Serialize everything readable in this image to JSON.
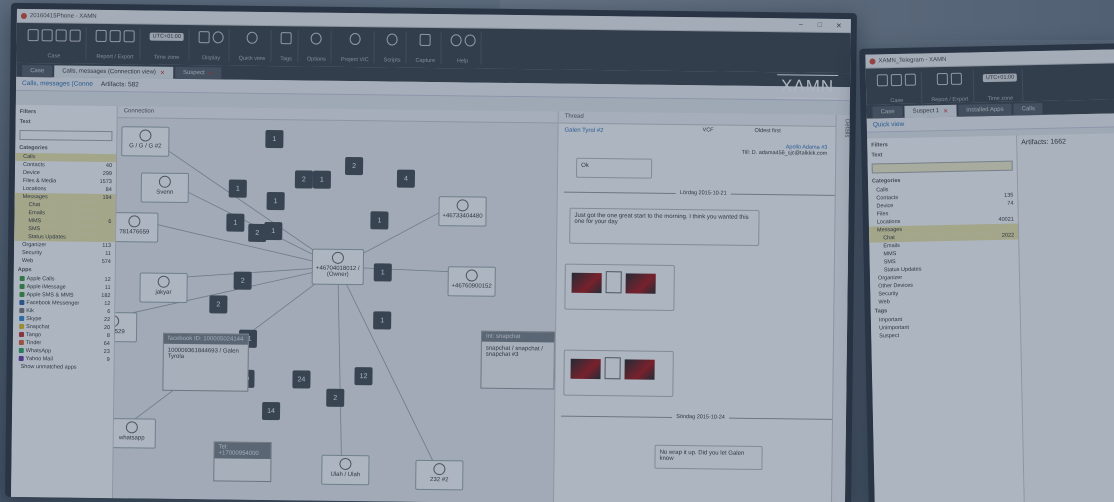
{
  "app": {
    "title_main": "20160415Phone - XAMN",
    "title_second": "XAMN_Telegram - XAMN",
    "brand": "XAMN"
  },
  "ribbon": {
    "groups": [
      {
        "label": "Case"
      },
      {
        "label": "Report / Export"
      },
      {
        "label": "Time zone",
        "value": "UTC+01:00"
      },
      {
        "label": "Display"
      },
      {
        "label": "Quick view"
      },
      {
        "label": "Tags"
      },
      {
        "label": "Options"
      },
      {
        "label": "Project VIC"
      },
      {
        "label": "Scripts"
      },
      {
        "label": "Capture"
      },
      {
        "label": "Help"
      }
    ]
  },
  "tabs": [
    {
      "label": "Case",
      "active": false
    },
    {
      "label": "Calls, messages (Connection view)",
      "active": true
    },
    {
      "label": "Suspect",
      "active": false
    }
  ],
  "toolbar": {
    "filter_link": "Calls, messages (Conne",
    "artifacts": "Artifacts: 582",
    "view_label": "Connection"
  },
  "sidebar": {
    "filters": "Filters",
    "text": "Text",
    "categories": "Categories",
    "items": [
      {
        "label": "Calls",
        "count": "",
        "hl": true
      },
      {
        "label": "Contacts",
        "count": "40",
        "hl": false
      },
      {
        "label": "Device",
        "count": "299",
        "hl": false
      },
      {
        "label": "Files & Media",
        "count": "1573",
        "hl": false
      },
      {
        "label": "Locations",
        "count": "84",
        "hl": false
      },
      {
        "label": "Messages",
        "count": "194",
        "hl": true
      },
      {
        "label": "Chat",
        "count": "",
        "hl": true,
        "sub": true
      },
      {
        "label": "Emails",
        "count": "",
        "hl": true,
        "sub": true
      },
      {
        "label": "MMS",
        "count": "6",
        "hl": true,
        "sub": true
      },
      {
        "label": "SMS",
        "count": "",
        "hl": true,
        "sub": true
      },
      {
        "label": "Status Updates",
        "count": "",
        "hl": true,
        "sub": true
      },
      {
        "label": "Organizer",
        "count": "113",
        "hl": false
      },
      {
        "label": "Security",
        "count": "11",
        "hl": false
      },
      {
        "label": "Web",
        "count": "574",
        "hl": false
      }
    ],
    "apps_label": "Apps",
    "apps": [
      {
        "label": "Apple Calls",
        "count": "12",
        "color": "#3a9a3a"
      },
      {
        "label": "Apple iMessage",
        "count": "11",
        "color": "#3a9a3a"
      },
      {
        "label": "Apple SMS & MMS",
        "count": "182",
        "color": "#3a9a3a"
      },
      {
        "label": "Facebook Messenger",
        "count": "12",
        "color": "#2f5fa8"
      },
      {
        "label": "Kik",
        "count": "6",
        "color": "#7a7a7a"
      },
      {
        "label": "Skype",
        "count": "22",
        "color": "#2a8ad6"
      },
      {
        "label": "Snapchat",
        "count": "20",
        "color": "#e0c020"
      },
      {
        "label": "Tango",
        "count": "8",
        "color": "#c43030"
      },
      {
        "label": "Tinder",
        "count": "64",
        "color": "#e06030"
      },
      {
        "label": "WhatsApp",
        "count": "23",
        "color": "#2aa85a"
      },
      {
        "label": "Yahoo Mail",
        "count": "9",
        "color": "#6a3aa8"
      }
    ],
    "show_more": "Show unmatched apps"
  },
  "graph": {
    "owner": "+46704018012 / (Owner)",
    "nodes": [
      {
        "label": "G / G / G #2"
      },
      {
        "label": "Svenn"
      },
      {
        "label": "781476659"
      },
      {
        "label": "jakyar"
      },
      {
        "label": "3219529"
      },
      {
        "label": "whatsapp"
      },
      {
        "label": "+46733404480"
      },
      {
        "label": "+46760900152"
      },
      {
        "label": "Ulah / Ulah"
      },
      {
        "label": "232 #2"
      }
    ],
    "numbers": [
      "1",
      "1",
      "1",
      "1",
      "2",
      "2",
      "4",
      "1",
      "2",
      "2",
      "1",
      "1",
      "2",
      "1",
      "11",
      "1",
      "20",
      "24",
      "2",
      "12",
      "14",
      "1"
    ],
    "card_fb": {
      "head": "facebook ID: 100005024144",
      "body": "100009361844693 / Galen Tyrola"
    },
    "card_snap": {
      "head": "Int: snapchat",
      "body": "snapchat / snapchat / snapchat #3"
    },
    "card_tel": {
      "head": "Tel: +17000954000"
    }
  },
  "thread": {
    "header": "Thread",
    "contact": "Galen Tyrol #2",
    "to": "Apollo Adama #3",
    "to_address": "Till: D. adama456_sjc@talkkik.com",
    "bubble1": "Ok",
    "date1": "Lördag 2015-10-21",
    "bubble2": "Just got the one great start to the morning. I think you wanted this one for your day",
    "date2": "Söndag 2015-10-24",
    "bubble3": "No wrap it up. Did you let Galen know",
    "vcf": "VCF",
    "order": "Oldest first"
  },
  "details": "Details",
  "second": {
    "tab": "Suspect 1",
    "tab2": "Installed Apps",
    "tab3": "Calls",
    "quickview": "Quick view",
    "artifacts": "Artifacts: 1662",
    "categories": [
      "Calls",
      "Contacts",
      "Device",
      "Files",
      "Locations",
      "Messages",
      "Chat",
      "Emails",
      "MMS",
      "SMS",
      "Status Updates",
      "Organizer",
      "Other Devices",
      "Security",
      "Web"
    ],
    "counts": [
      "",
      "135",
      "74",
      "",
      "40021",
      "",
      "2022",
      "",
      "",
      "",
      "",
      "",
      "",
      "",
      ""
    ],
    "tags_label": "Tags",
    "tags": [
      "Important",
      "Unimportant",
      "Suspect"
    ]
  }
}
